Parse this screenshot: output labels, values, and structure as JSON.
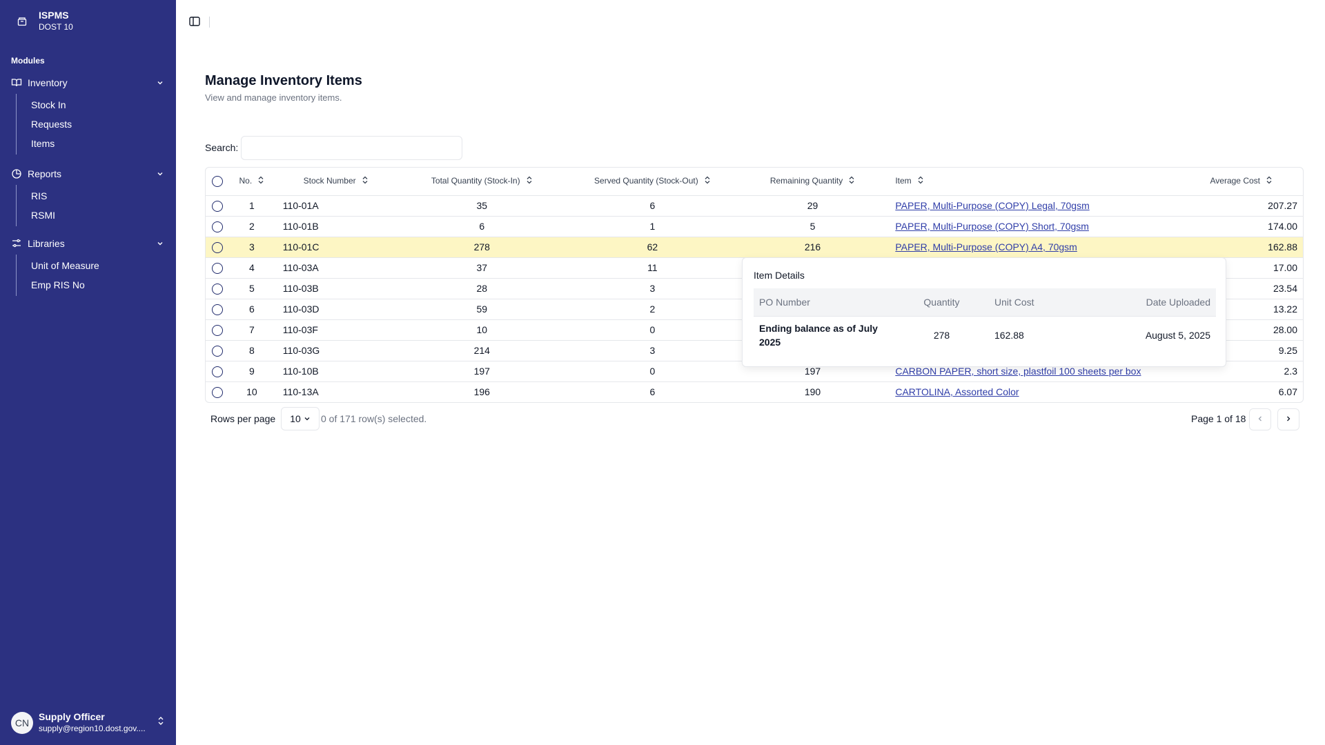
{
  "app": {
    "title": "ISPMS",
    "subtitle": "DOST 10"
  },
  "sidebar": {
    "modules_label": "Modules",
    "groups": [
      {
        "label": "Inventory",
        "icon": "book-icon",
        "items": [
          "Stock In",
          "Requests",
          "Items"
        ]
      },
      {
        "label": "Reports",
        "icon": "pie-chart-icon",
        "items": [
          "RIS",
          "RSMI"
        ]
      },
      {
        "label": "Libraries",
        "icon": "sliders-icon",
        "items": [
          "Unit of Measure",
          "Emp RIS No"
        ]
      }
    ]
  },
  "user": {
    "initials": "CN",
    "name": "Supply Officer",
    "email": "supply@region10.dost.gov...."
  },
  "page": {
    "title": "Manage Inventory Items",
    "subtitle": "View and manage inventory items."
  },
  "search": {
    "label": "Search:",
    "value": "",
    "placeholder": ""
  },
  "table": {
    "columns": [
      "No.",
      "Stock Number",
      "Total Quantity (Stock-In)",
      "Served Quantity (Stock-Out)",
      "Remaining Quantity",
      "Item",
      "Average Cost"
    ],
    "rows": [
      {
        "no": "1",
        "stock": "110-01A",
        "total": "35",
        "served": "6",
        "remaining": "29",
        "item": "PAPER, Multi-Purpose (COPY) Legal, 70gsm",
        "cost": "207.27"
      },
      {
        "no": "2",
        "stock": "110-01B",
        "total": "6",
        "served": "1",
        "remaining": "5",
        "item": "PAPER, Multi-Purpose (COPY) Short, 70gsm",
        "cost": "174.00"
      },
      {
        "no": "3",
        "stock": "110-01C",
        "total": "278",
        "served": "62",
        "remaining": "216",
        "item": "PAPER, Multi-Purpose (COPY) A4, 70gsm",
        "cost": "162.88",
        "highlighted": true
      },
      {
        "no": "4",
        "stock": "110-03A",
        "total": "37",
        "served": "11",
        "remaining": "",
        "item": "",
        "cost": "17.00"
      },
      {
        "no": "5",
        "stock": "110-03B",
        "total": "28",
        "served": "3",
        "remaining": "",
        "item": "",
        "cost": "23.54"
      },
      {
        "no": "6",
        "stock": "110-03D",
        "total": "59",
        "served": "2",
        "remaining": "",
        "item": "",
        "cost": "13.22"
      },
      {
        "no": "7",
        "stock": "110-03F",
        "total": "10",
        "served": "0",
        "remaining": "",
        "item": "",
        "cost": "28.00"
      },
      {
        "no": "8",
        "stock": "110-03G",
        "total": "214",
        "served": "3",
        "remaining": "",
        "item": "",
        "cost": "9.25"
      },
      {
        "no": "9",
        "stock": "110-10B",
        "total": "197",
        "served": "0",
        "remaining": "197",
        "item": "CARBON PAPER, short size, plastfoil 100 sheets per box",
        "cost": "2.3"
      },
      {
        "no": "10",
        "stock": "110-13A",
        "total": "196",
        "served": "6",
        "remaining": "190",
        "item": "CARTOLINA, Assorted Color",
        "cost": "6.07"
      }
    ]
  },
  "footer": {
    "rows_per_page_label": "Rows per page",
    "rows_per_page": "10",
    "selected": "0 of 171 row(s) selected.",
    "page_info": "Page 1 of 18"
  },
  "popover": {
    "title": "Item Details",
    "columns": [
      "PO Number",
      "Quantity",
      "Unit Cost",
      "Date Uploaded"
    ],
    "row": {
      "po": "Ending balance as of July 2025",
      "qty": "278",
      "unit_cost": "162.88",
      "date": "August 5, 2025"
    }
  },
  "colors": {
    "sidebar": "#2c3181",
    "highlight_row": "#fdf6c4",
    "link": "#2f3da8"
  }
}
